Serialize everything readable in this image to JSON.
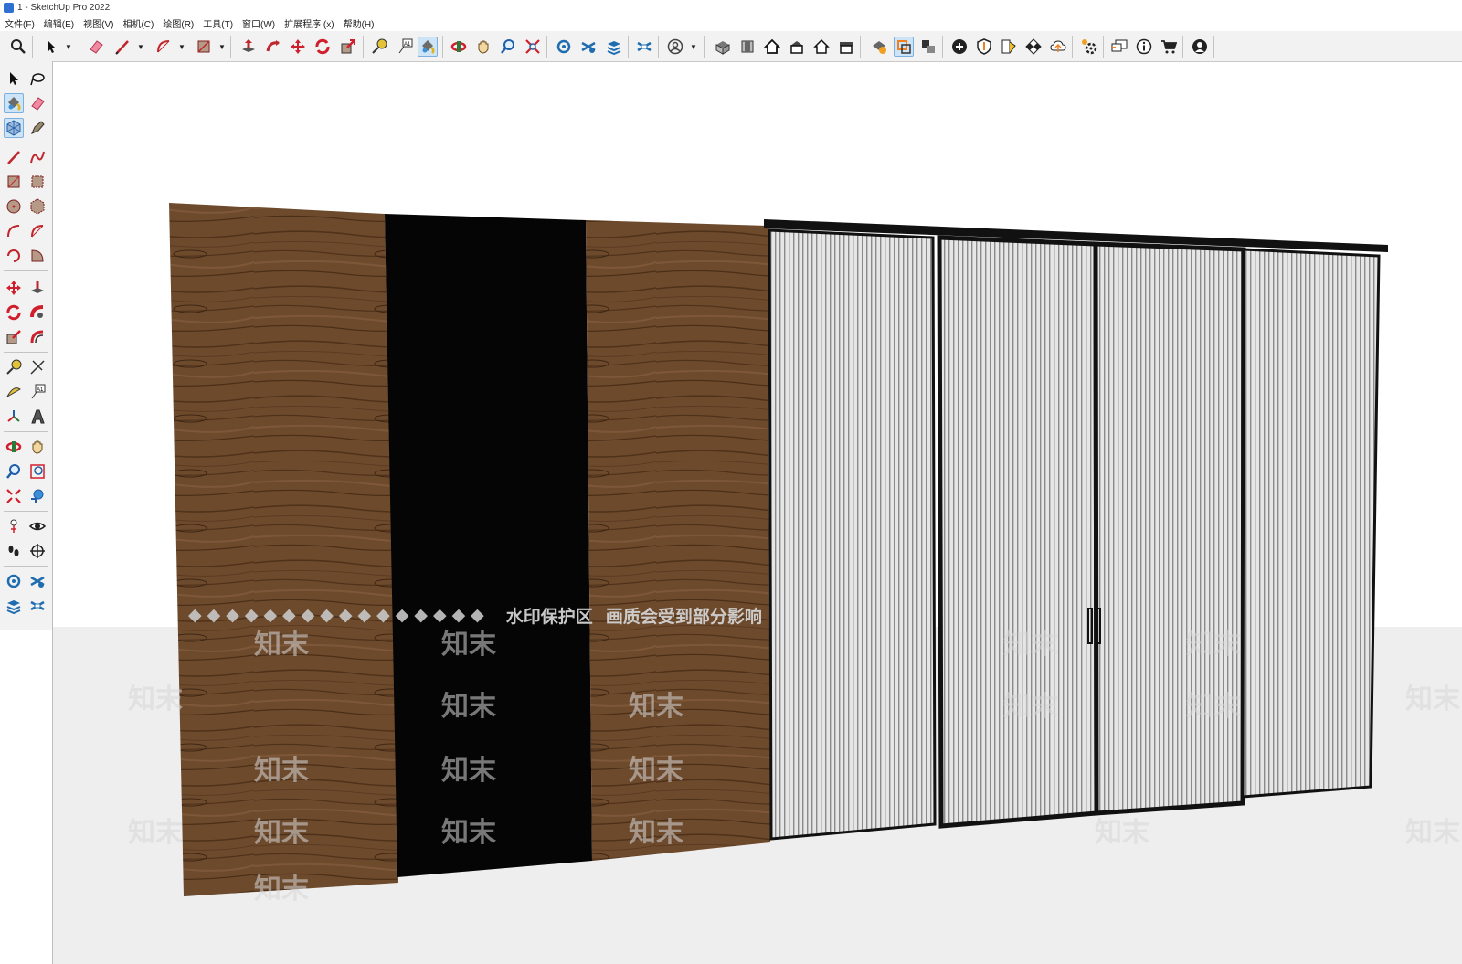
{
  "window": {
    "title": "1 - SketchUp Pro 2022"
  },
  "menu": [
    "文件(F)",
    "编辑(E)",
    "视图(V)",
    "相机(C)",
    "绘图(R)",
    "工具(T)",
    "窗口(W)",
    "扩展程序 (x)",
    "帮助(H)"
  ],
  "watermark": {
    "diamonds": "◆◆◆◆◆◆◆◆◆◆◆◆◆◆◆◆",
    "text1": "水印保护区",
    "text2": "画质会受到部分影响",
    "small": "知末"
  },
  "toolbar": {
    "label_tool_icon": "A1"
  },
  "colors": {
    "wood": "#6e4a2d",
    "wood_grain": "#4f3219",
    "black_panel": "#050505",
    "glass": "#e3e3e3",
    "frame": "#111111",
    "toolbar_bg": "#f2f2f2",
    "active_button": "#cde4f7"
  }
}
